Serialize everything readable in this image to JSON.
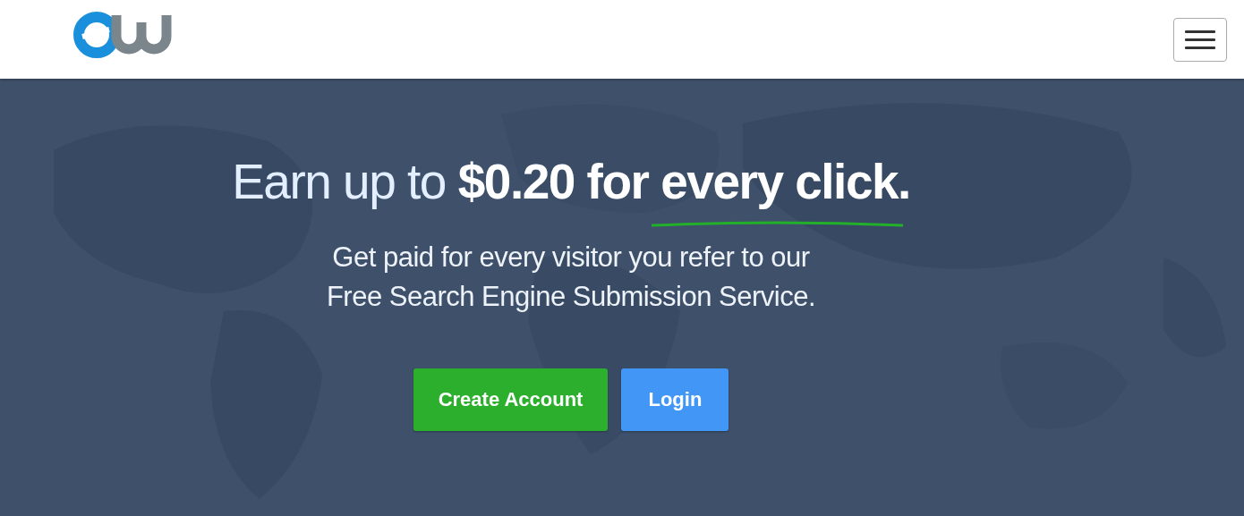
{
  "header": {
    "menu_button": {
      "kind": "hamburger"
    }
  },
  "hero": {
    "kind": "picture",
    "headline": "Earn up to **$0.20 for every click.**",
    "underlined": true,
    "subtitle_lines": [
      "Get paid for every visitor you refer to our",
      "Free Search Engine Submission Service."
    ],
    "buttons": [
      {
        "label": "Create Account",
        "kind": "primary"
      },
      {
        "label": "Login",
        "kind": "secondary"
      }
    ]
  }
}
